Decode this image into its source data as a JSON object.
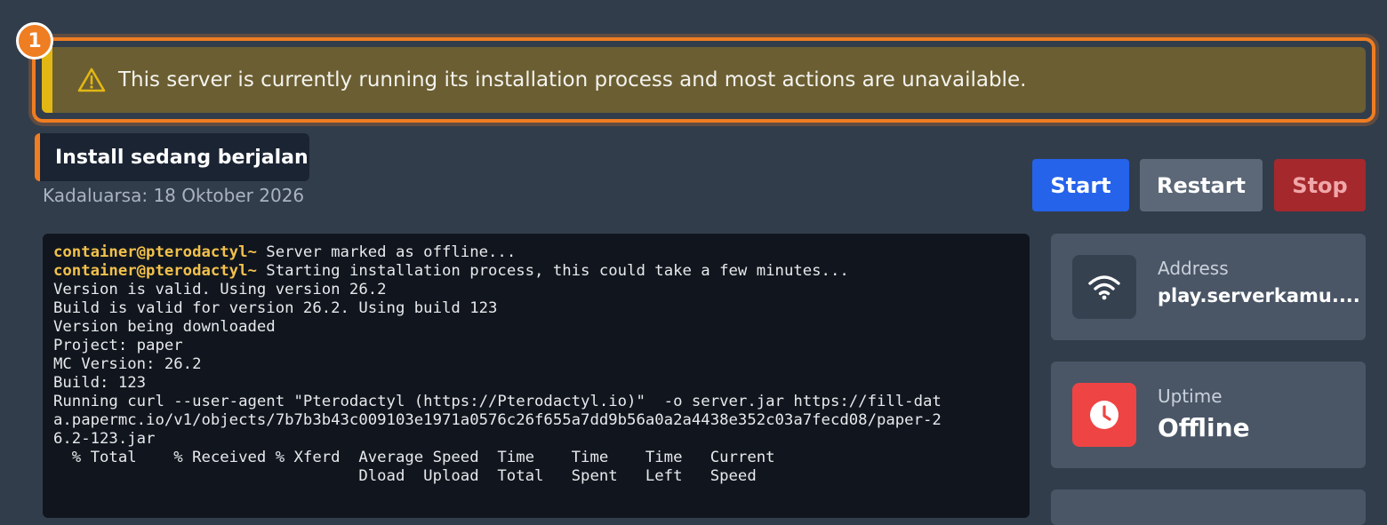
{
  "highlight": {
    "badge": "1"
  },
  "alert": {
    "message": "This server is currently running its installation process and most actions are unavailable."
  },
  "status": {
    "title": "Install sedang berjalan",
    "expiry": "Kadaluarsa: 18 Oktober 2026"
  },
  "controls": {
    "start": "Start",
    "restart": "Restart",
    "stop": "Stop"
  },
  "console": {
    "prompt": "container@pterodactyl~",
    "lines": [
      {
        "prompt": "container@pterodactyl~",
        "text": " Server marked as offline..."
      },
      {
        "prompt": "container@pterodactyl~",
        "text": " Starting installation process, this could take a few minutes..."
      },
      {
        "prompt": "",
        "text": "Version is valid. Using version 26.2"
      },
      {
        "prompt": "",
        "text": "Build is valid for version 26.2. Using build 123"
      },
      {
        "prompt": "",
        "text": "Version being downloaded"
      },
      {
        "prompt": "",
        "text": "Project: paper"
      },
      {
        "prompt": "",
        "text": "MC Version: 26.2"
      },
      {
        "prompt": "",
        "text": "Build: 123"
      },
      {
        "prompt": "",
        "text": "Running curl --user-agent \"Pterodactyl (https://Pterodactyl.io)\"  -o server.jar https://fill-dat"
      },
      {
        "prompt": "",
        "text": "a.papermc.io/v1/objects/7b7b3b43c009103e1971a0576c26f655a7dd9b56a0a2a4438e352c03a7fecd08/paper-2"
      },
      {
        "prompt": "",
        "text": "6.2-123.jar"
      },
      {
        "prompt": "",
        "text": "  % Total    % Received % Xferd  Average Speed  Time    Time    Time   Current"
      },
      {
        "prompt": "",
        "text": "                                 Dload  Upload  Total   Spent   Left   Speed"
      }
    ]
  },
  "cards": {
    "address": {
      "label": "Address",
      "value": "play.serverkamu....",
      "icon": "wifi-icon"
    },
    "uptime": {
      "label": "Uptime",
      "value": "Offline",
      "icon": "clock-icon"
    }
  },
  "colors": {
    "accent_orange": "#ef7d22",
    "warning": "#e2b714",
    "start": "#2563eb",
    "restart": "#5c6877",
    "stop": "#a5282d",
    "uptime_icon": "#ef4444"
  }
}
